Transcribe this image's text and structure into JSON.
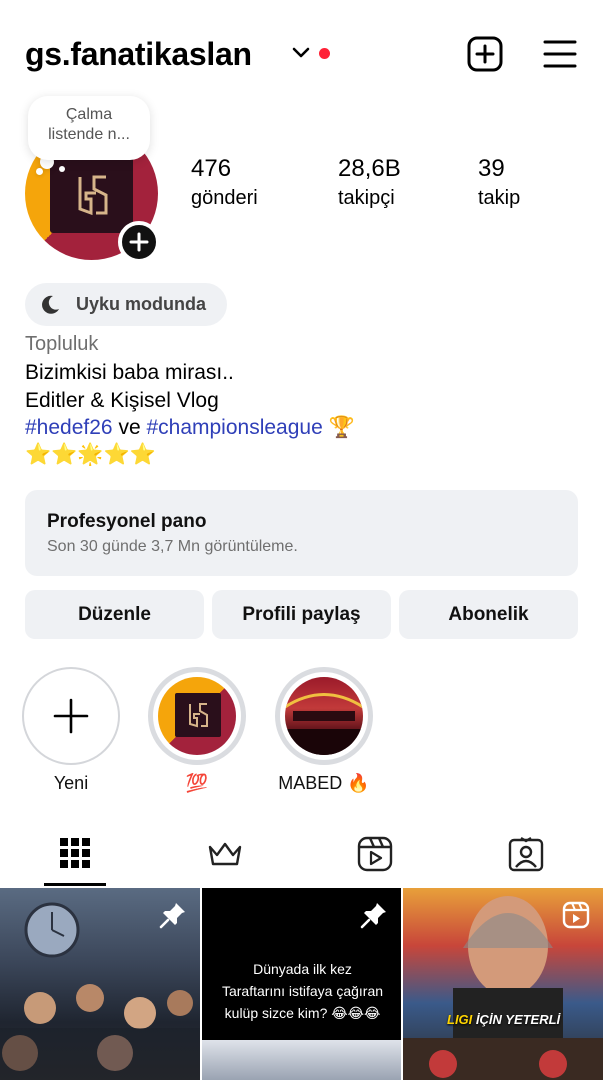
{
  "header": {
    "username": "gs.fanatikaslan",
    "notification_dot_color": "#ff2136"
  },
  "note": {
    "text": "Çalma listende n..."
  },
  "stats": [
    {
      "value": "476",
      "label": "gönderi"
    },
    {
      "value": "28,6B",
      "label": "takipçi"
    },
    {
      "value": "39",
      "label": "takip"
    }
  ],
  "status": {
    "label": "Uyku modunda"
  },
  "bio": {
    "category": "Topluluk",
    "line1": "Bizimkisi baba mirası..",
    "line2": "Editler & Kişisel Vlog",
    "hashtag1": "#hedef26",
    "connector": "ve",
    "hashtag2": "#championsleague",
    "trophy": "🏆",
    "stars": "⭐⭐🌟⭐⭐",
    "hashtag_color": "#2f3fb8"
  },
  "pro_dashboard": {
    "title": "Profesyonel pano",
    "subtitle": "Son 30 günde 3,7 Mn görüntüleme."
  },
  "buttons": {
    "edit": "Düzenle",
    "share": "Profili paylaş",
    "subscribe": "Abonelik"
  },
  "highlights": [
    {
      "label": "Yeni"
    },
    {
      "label": "💯"
    },
    {
      "label": "MABED 🔥"
    }
  ],
  "tabs": [
    "grid-icon",
    "crown-icon",
    "reels-icon",
    "tagged-icon"
  ],
  "posts": [
    {
      "pinned": true
    },
    {
      "pinned": true,
      "caption_line1": "Dünyada ilk kez",
      "caption_line2": "Taraftarını istifaya çağıran",
      "caption_line3": "kulüp sizce kim? 😂😂😂"
    },
    {
      "reel": true,
      "overlay_text_a": "LIGI",
      "overlay_text_b": " İÇİN YETERLİ"
    }
  ]
}
